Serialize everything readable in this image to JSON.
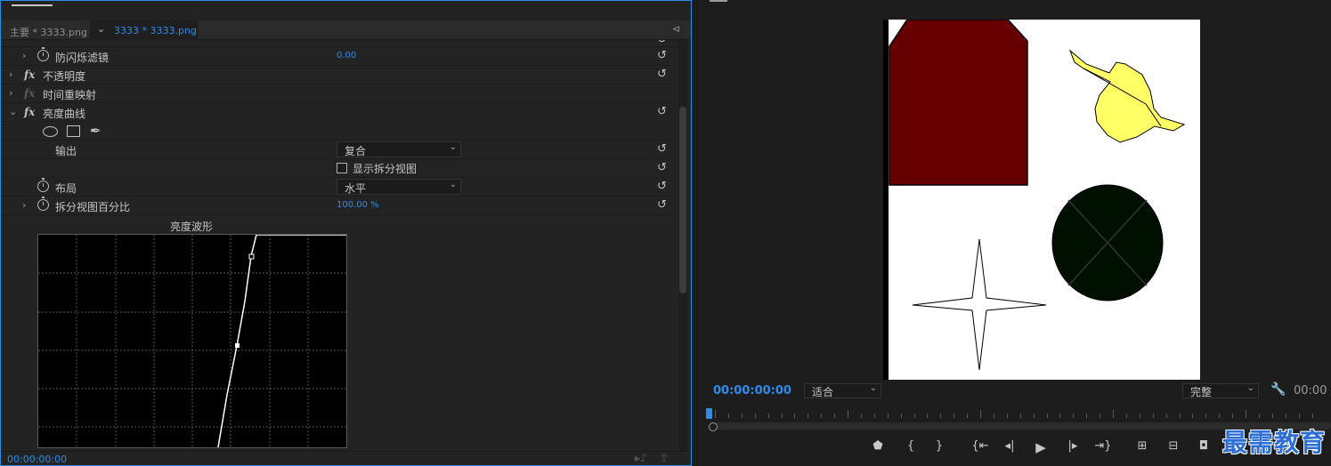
{
  "effect_controls": {
    "sequence_tab": "主要 * 3333.png",
    "clip_tab": "3333 * 3333.png",
    "rows": {
      "anti_flicker": {
        "label": "防闪烁滤镜",
        "value": "0.00"
      },
      "opacity": {
        "label": "不透明度"
      },
      "time_remap": {
        "label": "时间重映射"
      },
      "luma_curve": {
        "label": "亮度曲线"
      },
      "output": {
        "label": "输出",
        "value": "复合"
      },
      "show_split": {
        "label": "显示拆分视图",
        "checked": false
      },
      "layout": {
        "label": "布局",
        "value": "水平"
      },
      "split_percent": {
        "label": "拆分视图百分比",
        "value": "100.00 %"
      }
    },
    "waveform_title": "亮度波形",
    "timecode": "00:00:00:00"
  },
  "program_monitor": {
    "timecode": "00:00:00:00",
    "fit_select": "适合",
    "quality_select": "完整",
    "timecode_right": "00:00",
    "canvas": {
      "shapes": [
        "house-shape",
        "bird-shape",
        "circle-shape",
        "star-shape"
      ],
      "colors": {
        "house": "#660000",
        "bird": "#ffff66",
        "circle": "#001000",
        "star": "#ffffff"
      }
    }
  },
  "watermark": "最需教育",
  "colors": {
    "accent": "#2d8ceb",
    "panel_bg": "#232323",
    "curve_line": "#ffffff"
  },
  "icons": [
    "reset-icon",
    "stopwatch-icon",
    "chevron-right-icon",
    "ellipse-mask-icon",
    "rectangle-mask-icon",
    "pen-mask-icon",
    "wrench-icon",
    "marker-icon",
    "mark-in-icon",
    "mark-out-icon",
    "go-to-in-icon",
    "step-back-icon",
    "play-icon",
    "step-forward-icon",
    "go-to-out-icon",
    "insert-icon",
    "overwrite-icon",
    "camera-icon"
  ]
}
